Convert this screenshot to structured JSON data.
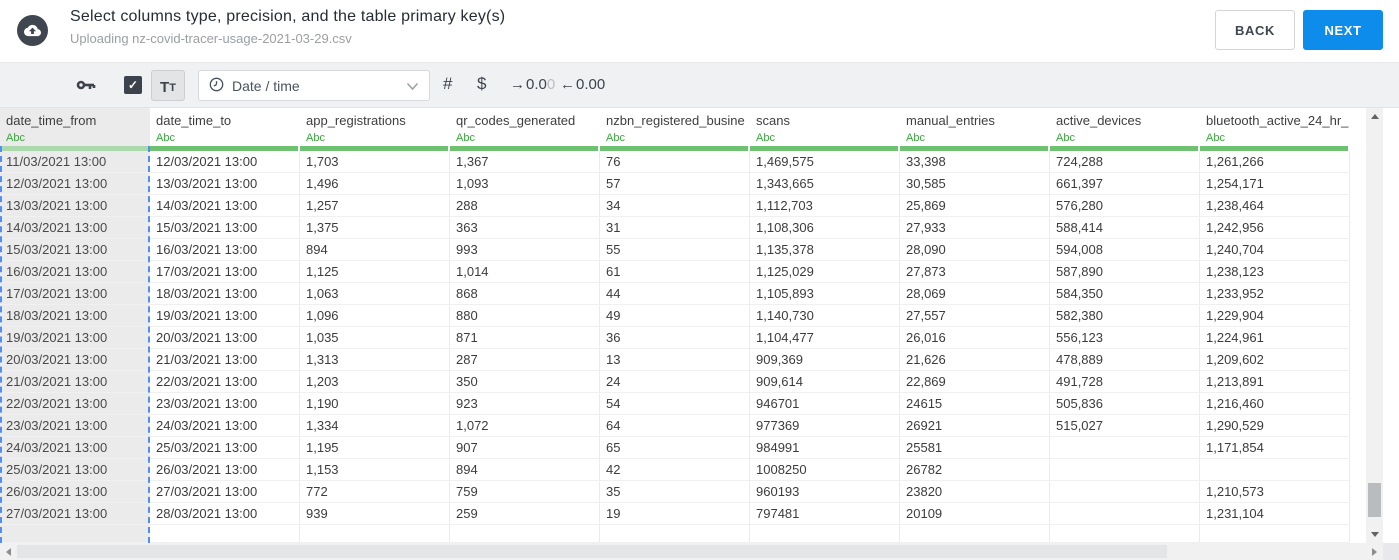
{
  "header": {
    "title": "Select columns type, precision, and the table primary key(s)",
    "subtitle": "Uploading nz-covid-tracer-usage-2021-03-29.csv",
    "back_label": "BACK",
    "next_label": "NEXT"
  },
  "toolbar": {
    "tt_button": {
      "t1": "T",
      "t2": "T"
    },
    "type_select": {
      "value": "Date / time"
    },
    "hash_label": "#",
    "dollar_label": "$",
    "increase_decimal": {
      "arrow": "→",
      "value_dark": "0.0",
      "value_light": "0"
    },
    "decrease_decimal": {
      "arrow": "←",
      "value": "0.00"
    }
  },
  "icons": {
    "upload": "cloud-upload-icon",
    "key": "primary-key-icon",
    "check": "✓",
    "clock": "clock-icon",
    "chevron": "chevron-down-icon"
  },
  "colors": {
    "accent_blue": "#0d8ceb",
    "type_green": "#3aa53c",
    "underline_green": "#6dc170",
    "underline_green_selected": "#abd9ab",
    "selection_dashed_blue": "#4e8ef6",
    "selected_column_bg": "#ebebeb",
    "toolbar_bg": "#f0f1f3"
  },
  "table": {
    "type_badge": "Abc",
    "columns": [
      {
        "name": "date_time_from",
        "selected": true
      },
      {
        "name": "date_time_to",
        "selected": false
      },
      {
        "name": "app_registrations",
        "selected": false
      },
      {
        "name": "qr_codes_generated",
        "selected": false
      },
      {
        "name": "nzbn_registered_busine",
        "selected": false
      },
      {
        "name": "scans",
        "selected": false
      },
      {
        "name": "manual_entries",
        "selected": false
      },
      {
        "name": "active_devices",
        "selected": false
      },
      {
        "name": "bluetooth_active_24_hr_",
        "selected": false
      }
    ],
    "rows": [
      [
        "11/03/2021 13:00",
        "12/03/2021 13:00",
        "1,703",
        "1,367",
        "76",
        "1,469,575",
        "33,398",
        "724,288",
        "1,261,266"
      ],
      [
        "12/03/2021 13:00",
        "13/03/2021 13:00",
        "1,496",
        "1,093",
        "57",
        "1,343,665",
        "30,585",
        "661,397",
        "1,254,171"
      ],
      [
        "13/03/2021 13:00",
        "14/03/2021 13:00",
        "1,257",
        "288",
        "34",
        "1,112,703",
        "25,869",
        "576,280",
        "1,238,464"
      ],
      [
        "14/03/2021 13:00",
        "15/03/2021 13:00",
        "1,375",
        "363",
        "31",
        "1,108,306",
        "27,933",
        "588,414",
        "1,242,956"
      ],
      [
        "15/03/2021 13:00",
        "16/03/2021 13:00",
        "894",
        "993",
        "55",
        "1,135,378",
        "28,090",
        "594,008",
        "1,240,704"
      ],
      [
        "16/03/2021 13:00",
        "17/03/2021 13:00",
        "1,125",
        "1,014",
        "61",
        "1,125,029",
        "27,873",
        "587,890",
        "1,238,123"
      ],
      [
        "17/03/2021 13:00",
        "18/03/2021 13:00",
        "1,063",
        "868",
        "44",
        "1,105,893",
        "28,069",
        "584,350",
        "1,233,952"
      ],
      [
        "18/03/2021 13:00",
        "19/03/2021 13:00",
        "1,096",
        "880",
        "49",
        "1,140,730",
        "27,557",
        "582,380",
        "1,229,904"
      ],
      [
        "19/03/2021 13:00",
        "20/03/2021 13:00",
        "1,035",
        "871",
        "36",
        "1,104,477",
        "26,016",
        "556,123",
        "1,224,961"
      ],
      [
        "20/03/2021 13:00",
        "21/03/2021 13:00",
        "1,313",
        "287",
        "13",
        "909,369",
        "21,626",
        "478,889",
        "1,209,602"
      ],
      [
        "21/03/2021 13:00",
        "22/03/2021 13:00",
        "1,203",
        "350",
        "24",
        "909,614",
        "22,869",
        "491,728",
        "1,213,891"
      ],
      [
        "22/03/2021 13:00",
        "23/03/2021 13:00",
        "1,190",
        "923",
        "54",
        "946701",
        "24615",
        "505,836",
        "1,216,460"
      ],
      [
        "23/03/2021 13:00",
        "24/03/2021 13:00",
        "1,334",
        "1,072",
        "64",
        "977369",
        "26921",
        "515,027",
        "1,290,529"
      ],
      [
        "24/03/2021 13:00",
        "25/03/2021 13:00",
        "1,195",
        "907",
        "65",
        "984991",
        "25581",
        "",
        "1,171,854"
      ],
      [
        "25/03/2021 13:00",
        "26/03/2021 13:00",
        "1,153",
        "894",
        "42",
        "1008250",
        "26782",
        "",
        ""
      ],
      [
        "26/03/2021 13:00",
        "27/03/2021 13:00",
        "772",
        "759",
        "35",
        "960193",
        "23820",
        "",
        "1,210,573"
      ],
      [
        "27/03/2021 13:00",
        "28/03/2021 13:00",
        "939",
        "259",
        "19",
        "797481",
        "20109",
        "",
        "1,231,104"
      ]
    ]
  }
}
